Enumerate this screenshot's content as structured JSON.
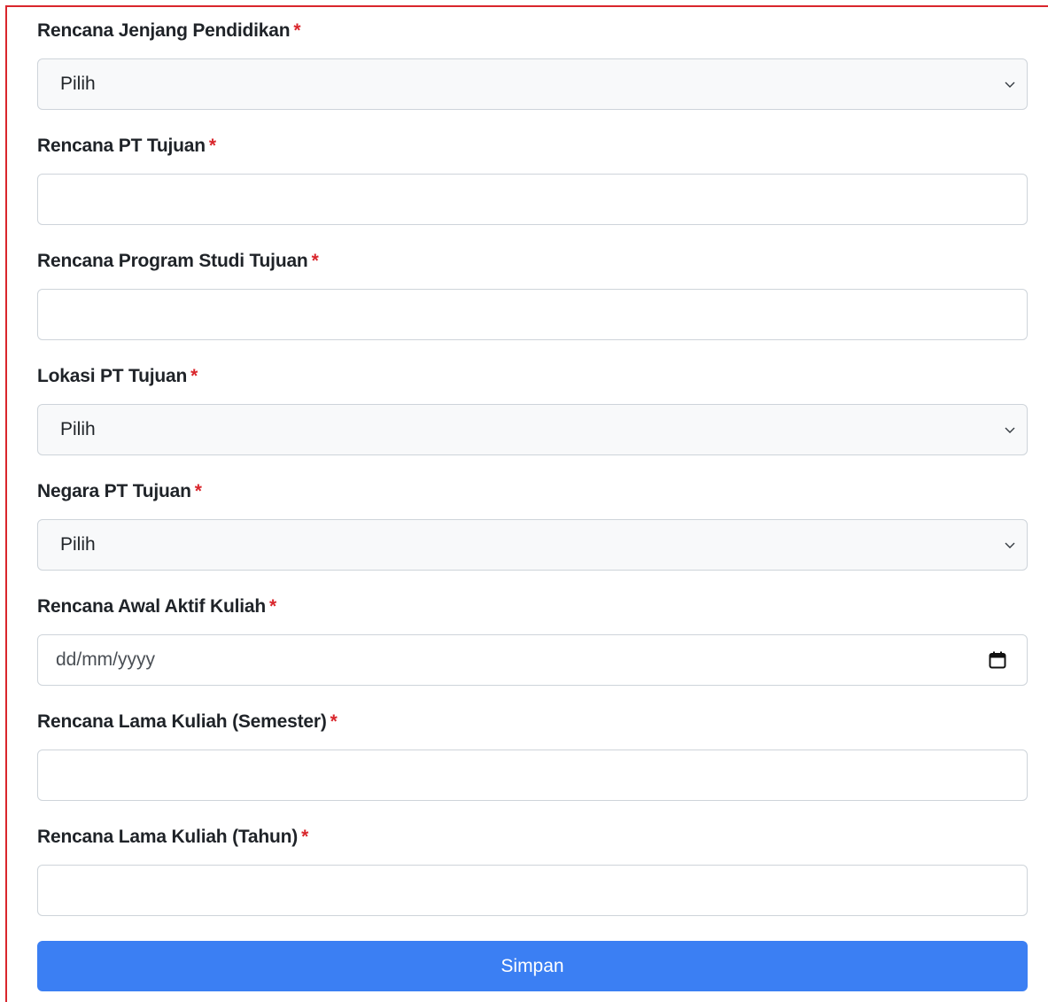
{
  "form": {
    "required_mark": "*",
    "fields": [
      {
        "label": "Rencana Jenjang Pendidikan",
        "value": "Pilih"
      },
      {
        "label": "Rencana PT Tujuan",
        "value": ""
      },
      {
        "label": "Rencana Program Studi Tujuan",
        "value": ""
      },
      {
        "label": "Lokasi PT Tujuan",
        "value": "Pilih"
      },
      {
        "label": "Negara PT Tujuan",
        "value": "Pilih"
      },
      {
        "label": "Rencana Awal Aktif Kuliah",
        "value": "dd/mm/yyyy"
      },
      {
        "label": "Rencana Lama Kuliah (Semester)",
        "value": ""
      },
      {
        "label": "Rencana Lama Kuliah (Tahun)",
        "value": ""
      }
    ],
    "submit_label": "Simpan"
  },
  "icons": {
    "select": "chevron-down-icon",
    "date": "calendar-icon"
  },
  "colors": {
    "required": "#d9262c",
    "primary_button": "#3b7ff3",
    "frame_border": "#d9262c"
  }
}
